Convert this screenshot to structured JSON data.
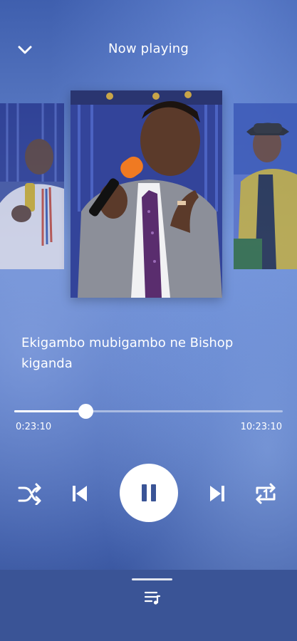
{
  "header": {
    "title": "Now playing",
    "collapse_icon": "chevron-down-icon"
  },
  "artwork": {
    "items": [
      "previous-track-art",
      "current-track-art",
      "next-track-art"
    ]
  },
  "track": {
    "title": "Ekigambo mubigambo ne Bishop kiganda"
  },
  "playback": {
    "elapsed": "0:23:10",
    "total": "10:23:10",
    "progress_fraction": 0.266,
    "state": "playing"
  },
  "controls": {
    "shuffle_icon": "shuffle-icon",
    "previous_icon": "skip-previous-icon",
    "pause_icon": "pause-icon",
    "next_icon": "skip-next-icon",
    "repeat_icon": "repeat-one-icon"
  },
  "bottom_panel": {
    "queue_icon": "queue-music-icon"
  },
  "colors": {
    "accent": "#ffffff",
    "panel": "#3a5496",
    "background_top": "#3f5fae",
    "background_mid": "#6f8fd4"
  }
}
